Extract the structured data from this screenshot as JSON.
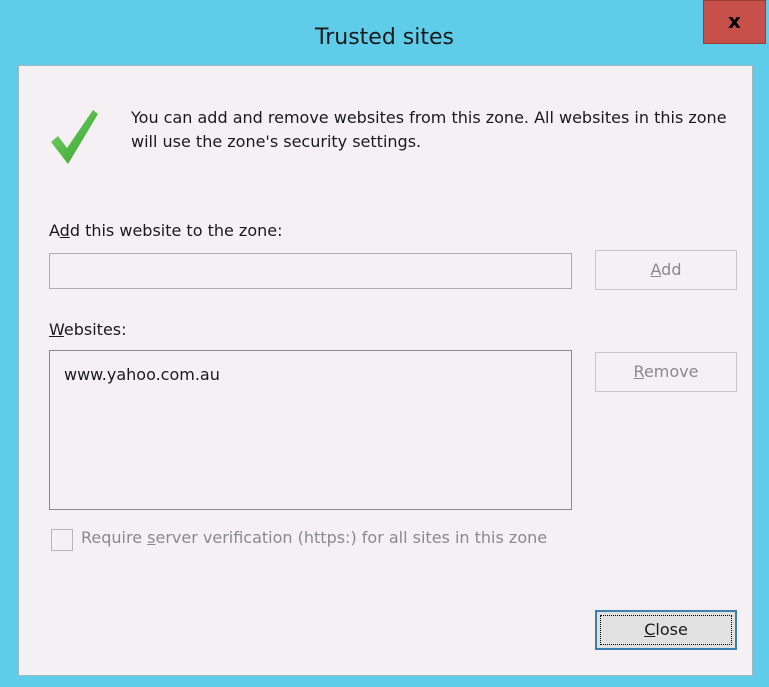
{
  "window": {
    "title": "Trusted sites",
    "close_glyph": "x",
    "titlebar_color": "#5fcdea",
    "close_color": "#c7504a"
  },
  "intro": {
    "icon": "green-checkmark-icon",
    "text": "You can add and remove websites from this zone. All websites in this zone will use the zone's security settings."
  },
  "add_section": {
    "label_pre": "A",
    "label_underlined": "d",
    "label_post": "d this website to the zone:",
    "input_value": "",
    "add_button_underlined": "A",
    "add_button_rest": "dd"
  },
  "websites_section": {
    "label_underlined": "W",
    "label_post": "ebsites:",
    "items": [
      "www.yahoo.com.au"
    ],
    "remove_button_underlined": "R",
    "remove_button_rest": "emove"
  },
  "https_option": {
    "checked": false,
    "label_pre": "Require ",
    "label_underlined": "s",
    "label_post": "erver verification (https:) for all sites in this zone"
  },
  "footer": {
    "close_underlined": "C",
    "close_rest": "lose"
  }
}
